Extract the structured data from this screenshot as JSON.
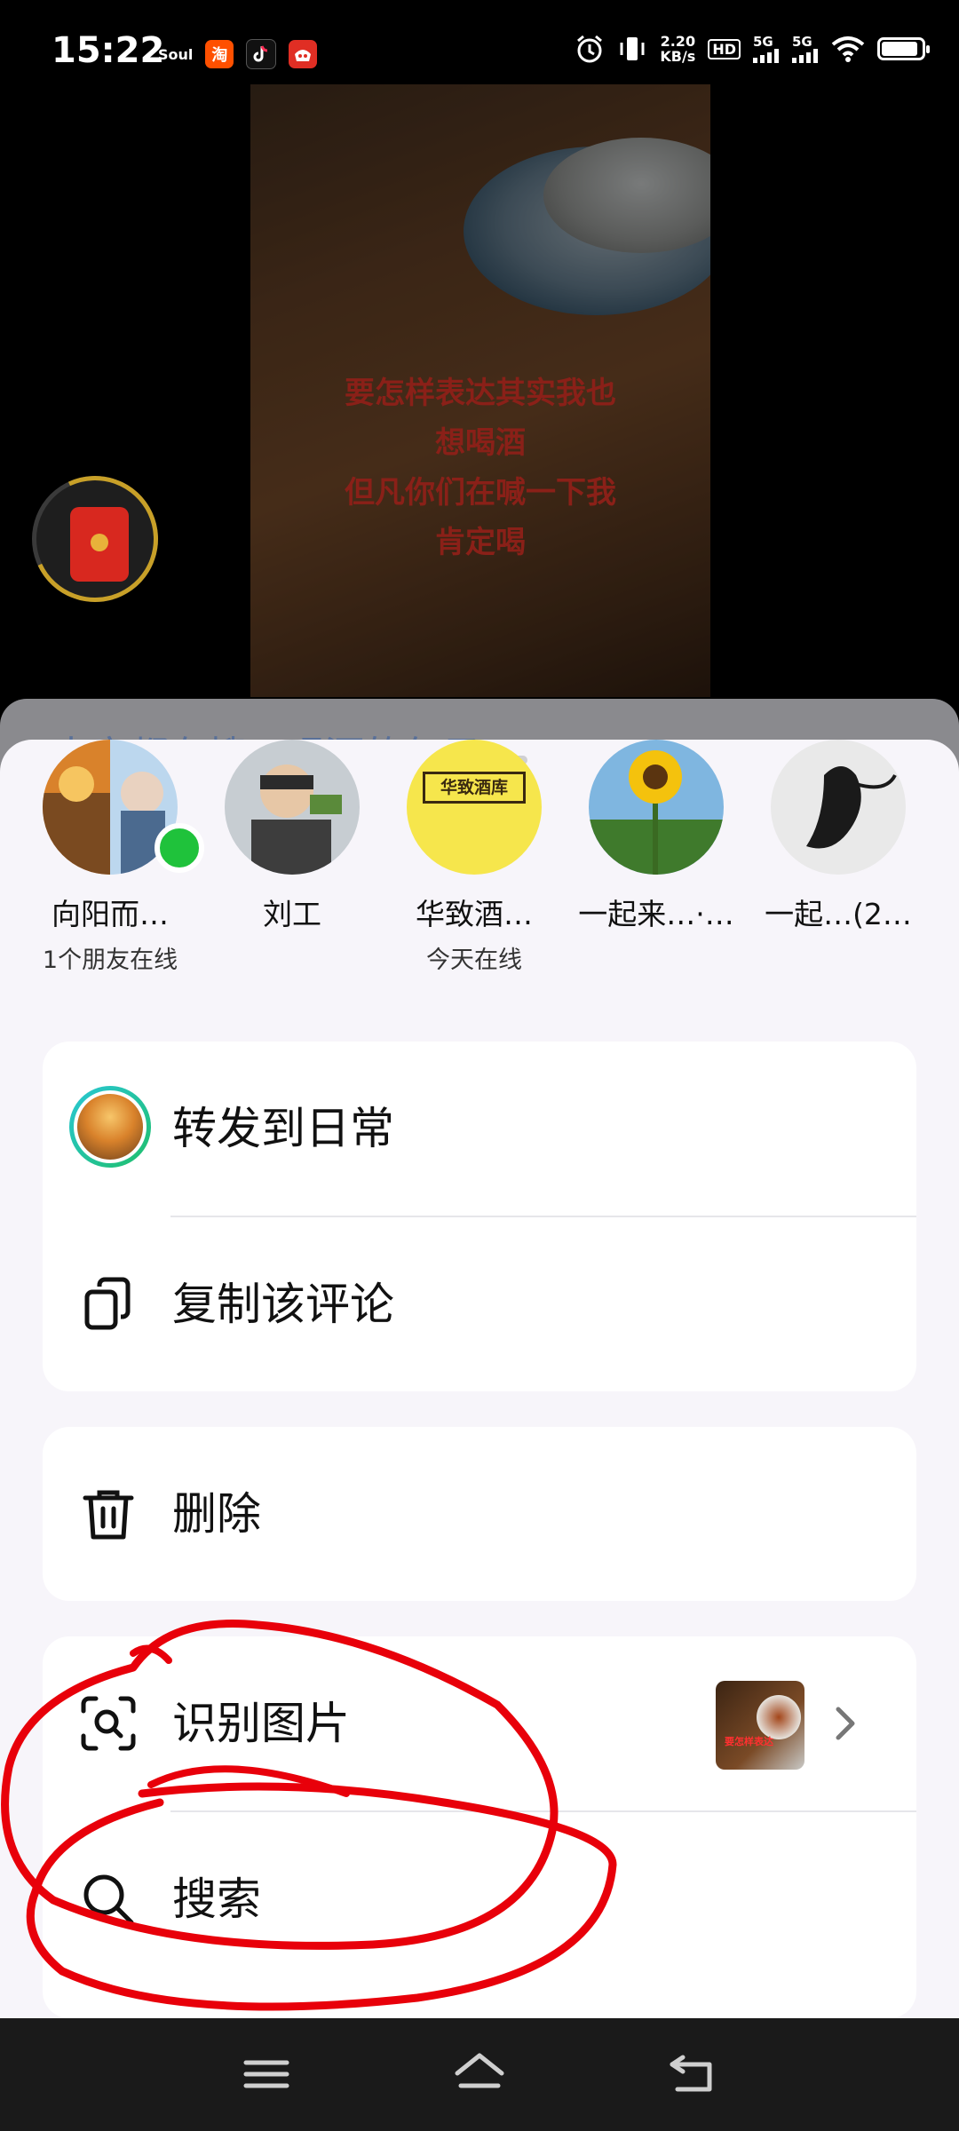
{
  "status_bar": {
    "time": "15:22",
    "soul_label": "Soul",
    "app_icons": [
      "taobao-icon",
      "tiktok-icon",
      "pinduoduo-icon"
    ],
    "taobao_char": "淘",
    "net_speed_value": "2.20",
    "net_speed_unit": "KB/s",
    "hd_label": "HD",
    "sim1_label": "5G",
    "sim2_label": "5G",
    "battery_level": 0.84
  },
  "video": {
    "caption_lines": [
      "要怎样表达其实我也",
      "想喝酒",
      "但凡你们在喊一下我",
      "肯定喝"
    ]
  },
  "behind_text": "大家都在搜：喝酒的句子",
  "share_sheet": {
    "contacts": [
      {
        "name": "向阳而…",
        "subtitle": "1个朋友在线"
      },
      {
        "name": "刘工",
        "subtitle": ""
      },
      {
        "name": "华致酒…",
        "subtitle": "今天在线",
        "avatar_text": "华致酒库"
      },
      {
        "name": "一起来…·…",
        "subtitle": ""
      },
      {
        "name": "一起…(2…",
        "subtitle": ""
      }
    ],
    "actions_group1": [
      {
        "label": "转发到日常",
        "icon": "daily-avatar-icon"
      },
      {
        "label": "复制该评论",
        "icon": "copy-icon"
      }
    ],
    "actions_group2": [
      {
        "label": "删除",
        "icon": "trash-icon"
      }
    ],
    "actions_group3": [
      {
        "label": "识别图片",
        "icon": "scan-image-icon"
      },
      {
        "label": "搜索",
        "icon": "search-icon"
      }
    ],
    "thumbnail_text": "要怎样表达"
  },
  "colors": {
    "sheet_bg": "#f7f5fa",
    "card_bg": "#ffffff",
    "online_green": "#1fc23b",
    "annotation_red": "#e8000a"
  }
}
